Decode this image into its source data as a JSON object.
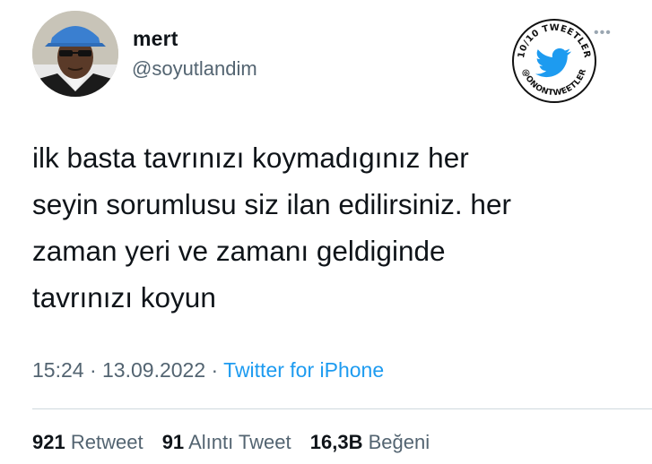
{
  "author": {
    "name": "mert",
    "handle": "@soyutlandim"
  },
  "more_icon": "more-horizontal-icon",
  "badge": {
    "top_text": "10/10 TWEETLER",
    "bottom_text": "@ONONTWEETLER",
    "icon": "twitter-bird-icon",
    "bird_color": "#1d9bf0"
  },
  "tweet": {
    "lines": [
      "ilk basta tavrınızı koymadıgınız her",
      "seyin sorumlusu siz ilan edilirsiniz. her",
      "zaman yeri ve zamanı geldiginde",
      "tavrınızı koyun"
    ]
  },
  "meta": {
    "time": "15:24",
    "separator": " · ",
    "date": "13.09.2022",
    "source": "Twitter for iPhone"
  },
  "stats": {
    "retweets_count": "921",
    "retweets_label": "Retweet",
    "quotes_count": "91",
    "quotes_label": "Alıntı Tweet",
    "likes_count": "16,3B",
    "likes_label": "Beğeni"
  },
  "colors": {
    "text": "#0f1419",
    "secondary": "#536471",
    "link": "#1d9bf0",
    "divider": "#cfd9de"
  }
}
